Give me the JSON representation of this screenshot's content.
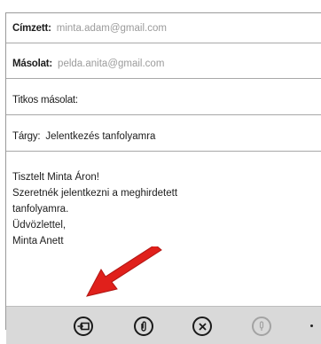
{
  "email": {
    "to_label": "Címzett:",
    "to_value": "minta.adam@gmail.com",
    "cc_label": "Másolat:",
    "cc_value": "pelda.anita@gmail.com",
    "bcc_label": "Titkos másolat:",
    "subject_label": "Tárgy:",
    "subject_value": "Jelentkezés tanfolyamra",
    "body": {
      "greeting": "Tisztelt Minta Áron!",
      "line1": "Szeretnék jelentkezni a meghirdetett",
      "line2": "tanfolyamra.",
      "line3": "Üdvözlettel,",
      "line4": "Minta Anett"
    }
  },
  "app_bar": {
    "buttons": [
      {
        "name": "send",
        "icon": "send-icon"
      },
      {
        "name": "attach",
        "icon": "paperclip-icon"
      },
      {
        "name": "discard",
        "icon": "close-icon"
      },
      {
        "name": "voice",
        "icon": "microphone-icon",
        "disabled": true
      }
    ]
  },
  "annotation": {
    "arrow_color": "#e0201b"
  },
  "colors": {
    "app_bar_bg": "#d9d9d9",
    "field_border": "#a8a8a8",
    "placeholder_text": "#9b9b9b"
  }
}
